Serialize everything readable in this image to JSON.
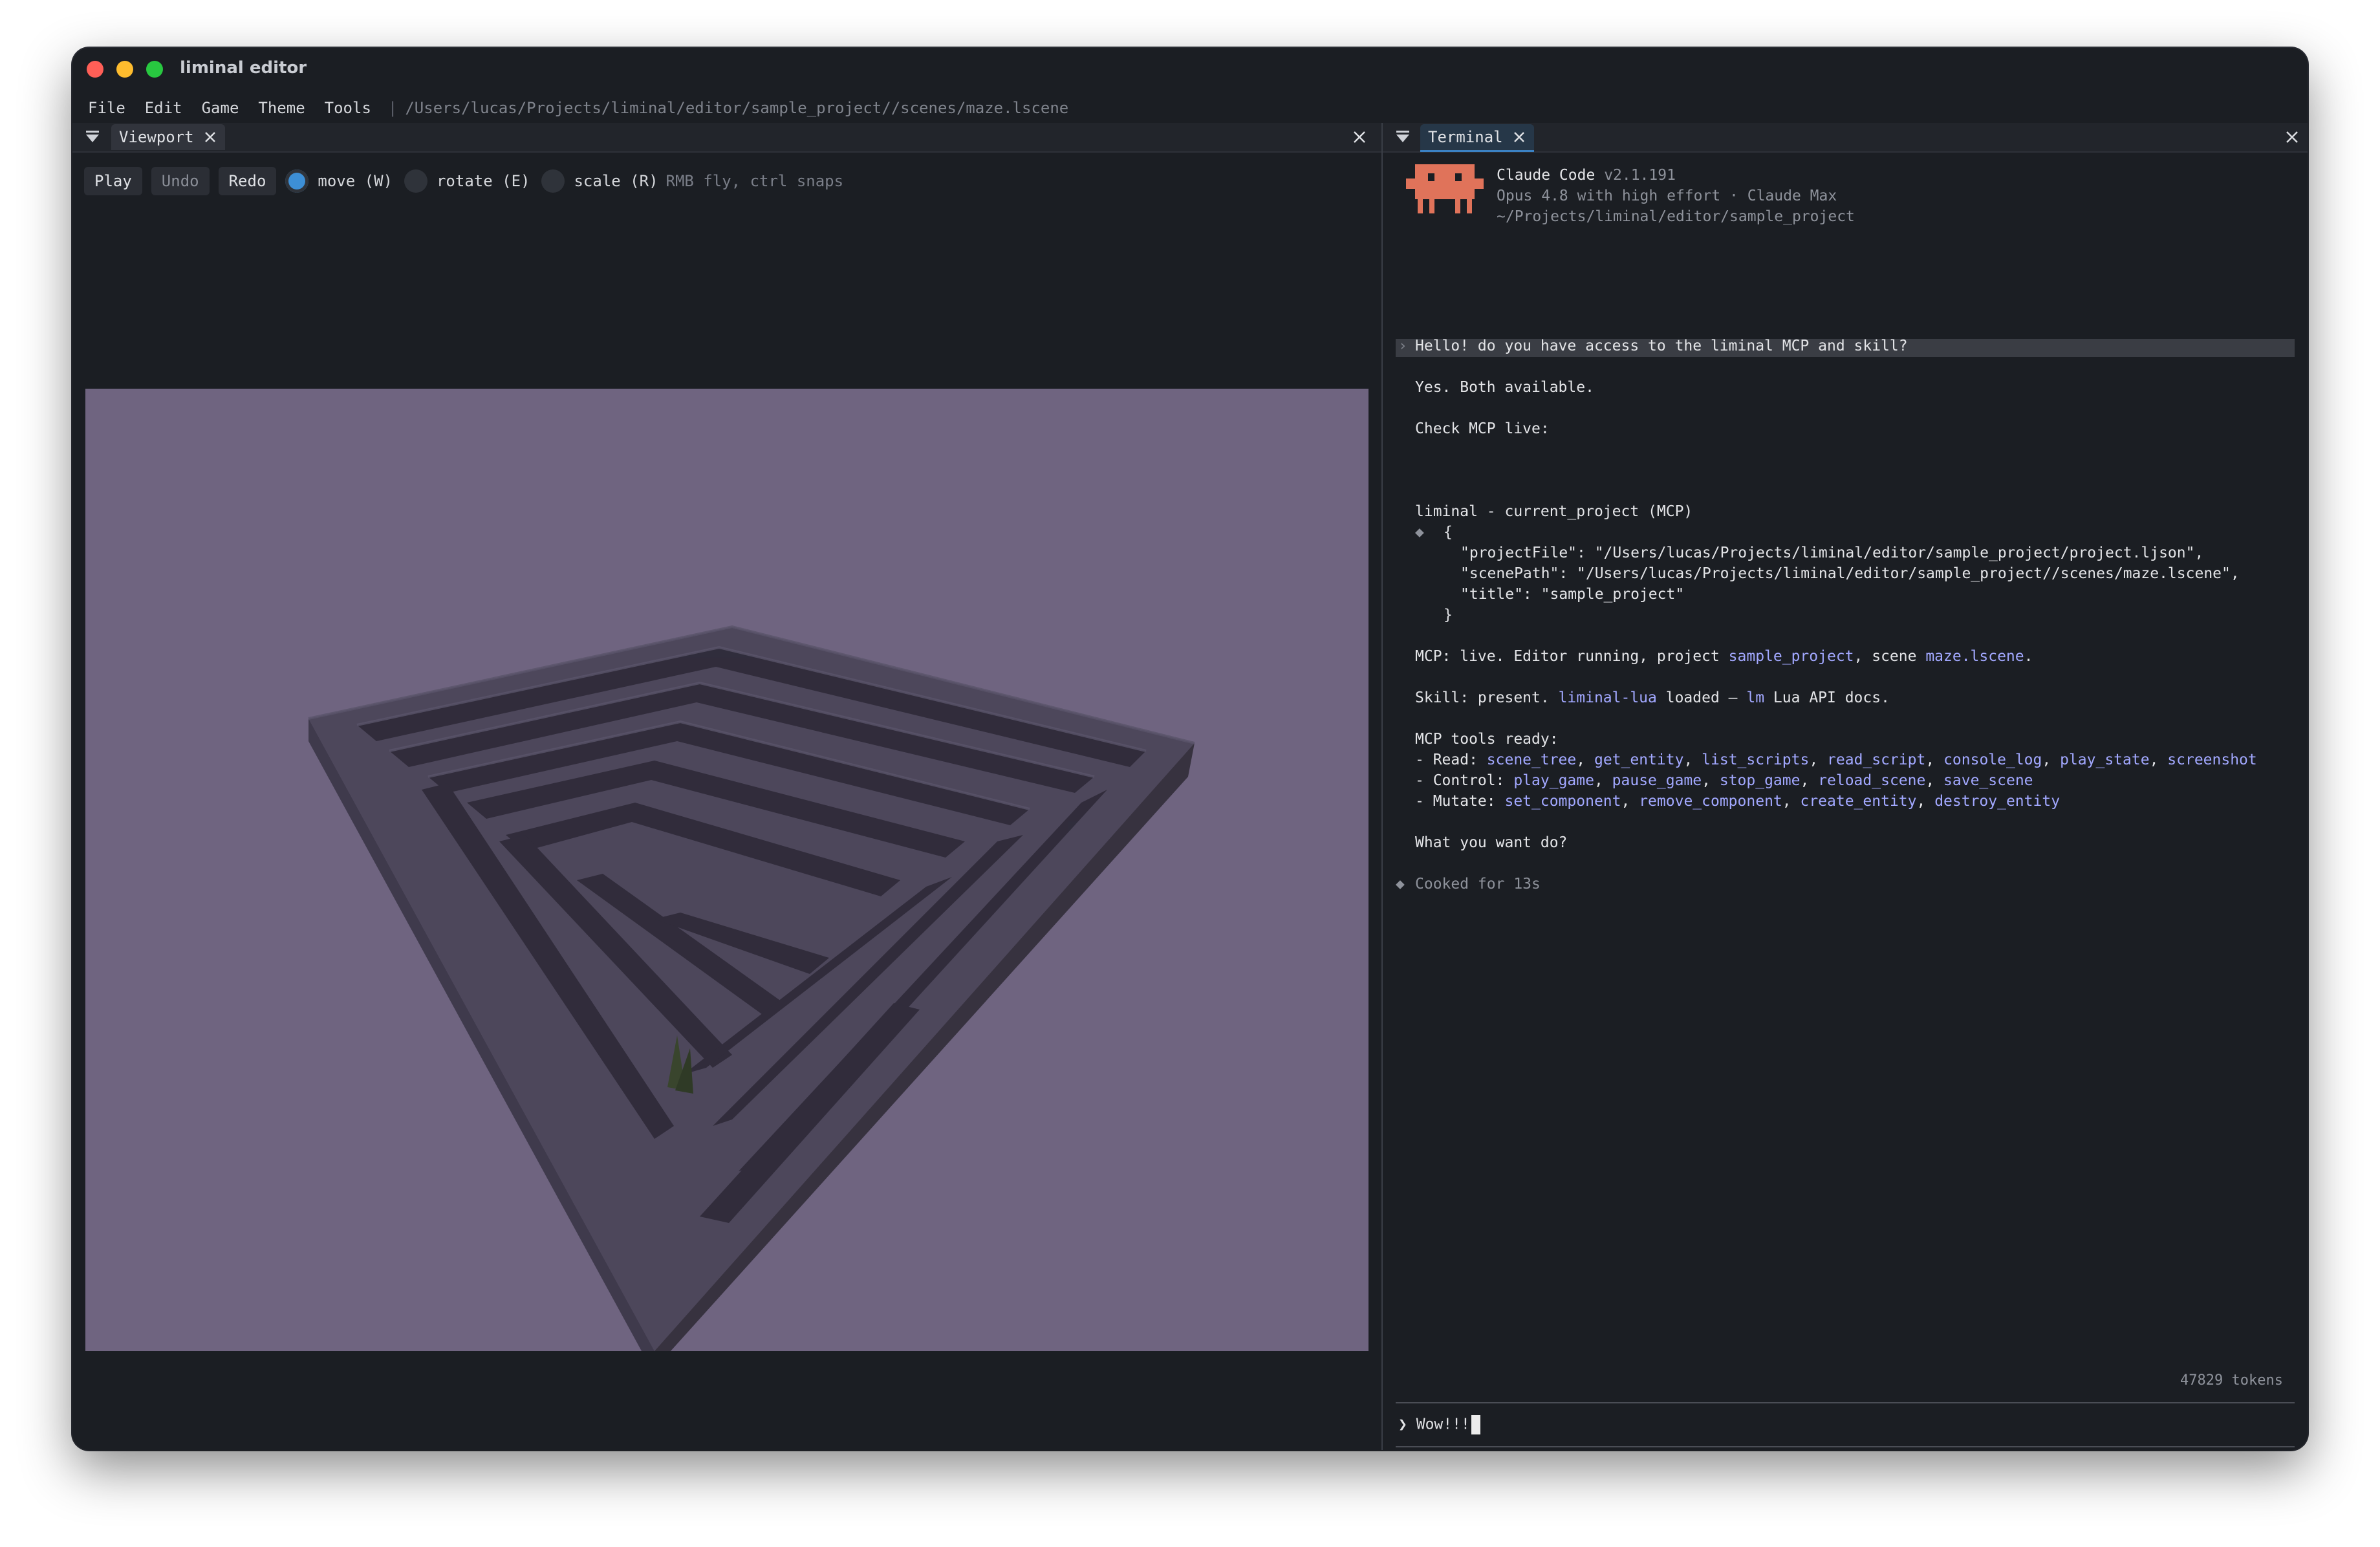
{
  "window": {
    "title": "liminal editor"
  },
  "menu": {
    "items": [
      "File",
      "Edit",
      "Game",
      "Theme",
      "Tools"
    ],
    "separator": "|",
    "path": "/Users/lucas/Projects/liminal/editor/sample_project//scenes/maze.lscene"
  },
  "left_panel": {
    "tab_label": "Viewport",
    "toolbar": {
      "play": "Play",
      "undo": "Undo",
      "redo": "Redo",
      "modes": [
        {
          "label": "move (W)",
          "selected": true
        },
        {
          "label": "rotate (E)",
          "selected": false
        },
        {
          "label": "scale (R)",
          "selected": false
        }
      ],
      "hint": "RMB fly, ctrl snaps"
    },
    "viewport": {
      "background": "#6f6480",
      "maze_color": "#4a4558"
    }
  },
  "right_panel": {
    "tab_label": "Terminal",
    "header": {
      "name": "Claude Code",
      "version": "v2.1.191",
      "model": "Opus 4.8 with high effort · Claude Max",
      "cwd": "~/Projects/liminal/editor/sample_project"
    },
    "user_prompt": "Hello! do you have access to the liminal MCP and skill?",
    "reply_1": "Yes. Both available.",
    "reply_2": "Check MCP live:",
    "tool_call": "liminal - current_project (MCP)",
    "json_lines": [
      "{",
      "\"projectFile\": \"/Users/lucas/Projects/liminal/editor/sample_project/project.ljson\",",
      "\"scenePath\": \"/Users/lucas/Projects/liminal/editor/sample_project//scenes/maze.lscene\",",
      "\"title\": \"sample_project\"",
      "}"
    ],
    "mcp_status": {
      "prefix": "MCP: live. Editor running, project ",
      "project": "sample_project",
      "mid": ", scene ",
      "scene": "maze.lscene",
      "suffix": "."
    },
    "skill_status": {
      "prefix": "Skill: present. ",
      "skill": "liminal-lua",
      "mid": " loaded — ",
      "lm": "lm",
      "suffix": " Lua API docs."
    },
    "tools_heading": "MCP tools ready:",
    "tool_groups": [
      {
        "label": "- Read: ",
        "tools": [
          "scene_tree",
          "get_entity",
          "list_scripts",
          "read_script",
          "console_log",
          "play_state",
          "screenshot"
        ]
      },
      {
        "label": "- Control: ",
        "tools": [
          "play_game",
          "pause_game",
          "stop_game",
          "reload_scene",
          "save_scene"
        ]
      },
      {
        "label": "- Mutate: ",
        "tools": [
          "set_component",
          "remove_component",
          "create_entity",
          "destroy_entity"
        ]
      }
    ],
    "question": "What you want do?",
    "cooked": "Cooked for 13s",
    "tokens": "47829 tokens",
    "input_prompt": "❯",
    "input_value": "Wow!!!"
  },
  "colors": {
    "accent": "#3d8fd6",
    "link": "#a2a8ff",
    "logo": "#e0735a"
  }
}
